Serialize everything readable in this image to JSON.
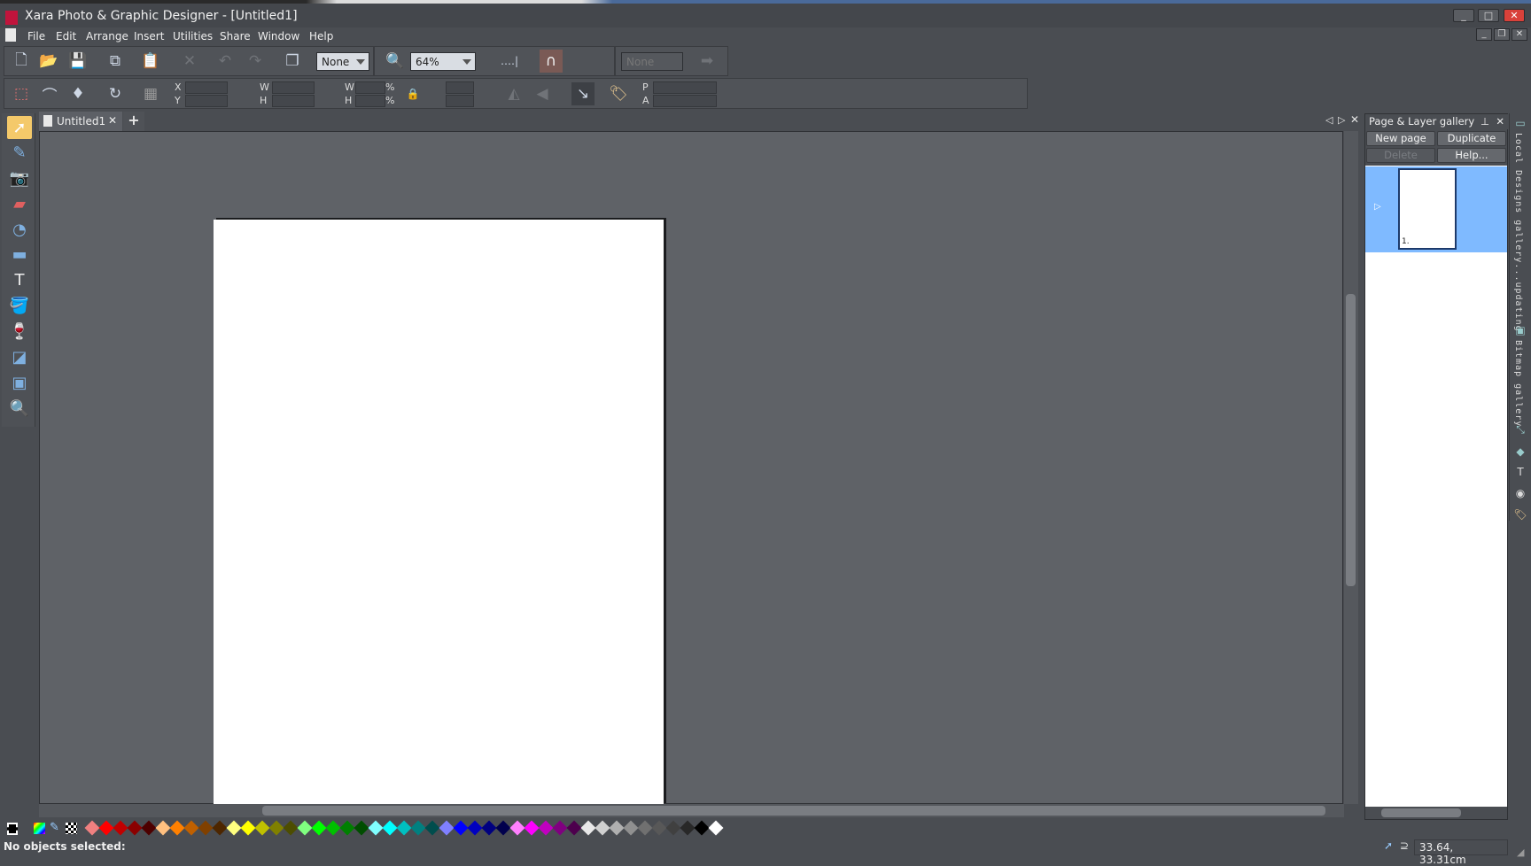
{
  "window": {
    "title": "Xara Photo & Graphic Designer - [Untitled1]"
  },
  "menu": [
    "File",
    "Edit",
    "Arrange",
    "Insert",
    "Utilities",
    "Share",
    "Window",
    "Help"
  ],
  "toolbar": {
    "quality_combo": "None",
    "zoom_combo": "64%",
    "disabled_combo": "None"
  },
  "infobar": {
    "x_label": "X",
    "y_label": "Y",
    "w_label": "W",
    "h_label": "H",
    "w2_label": "W",
    "h2_label": "H",
    "pct": "%",
    "p_label": "P",
    "a_label": "A"
  },
  "tabs": [
    {
      "label": "Untitled1"
    }
  ],
  "gallery": {
    "title": "Page & Layer gallery",
    "new_page": "New page",
    "duplicate": "Duplicate",
    "delete": "Delete",
    "help": "Help...",
    "page_number": "1."
  },
  "side_tabs": [
    "Local Designs gallery...updating",
    "Bitmap gallery"
  ],
  "palette": [
    "#f08080",
    "#ff0000",
    "#c00000",
    "#8b0000",
    "#4d0000",
    "#ffc080",
    "#ff8000",
    "#c06000",
    "#804000",
    "#4d2600",
    "#ffff80",
    "#ffff00",
    "#c0c000",
    "#808000",
    "#4d4d00",
    "#80ff80",
    "#00ff00",
    "#00c000",
    "#008000",
    "#004d00",
    "#80ffff",
    "#00ffff",
    "#00c0c0",
    "#008080",
    "#004d4d",
    "#8080ff",
    "#0000ff",
    "#0000c0",
    "#000080",
    "#00004d",
    "#ff80ff",
    "#ff00ff",
    "#c000c0",
    "#800080",
    "#4d004d",
    "#e8e8e8",
    "#d0d0d0",
    "#b0b0b0",
    "#909090",
    "#707070",
    "#585858",
    "#404040",
    "#282828",
    "#000000",
    "#ffffff"
  ],
  "status": {
    "message": "No objects selected:",
    "coords": "33.64, 33.31cm"
  }
}
